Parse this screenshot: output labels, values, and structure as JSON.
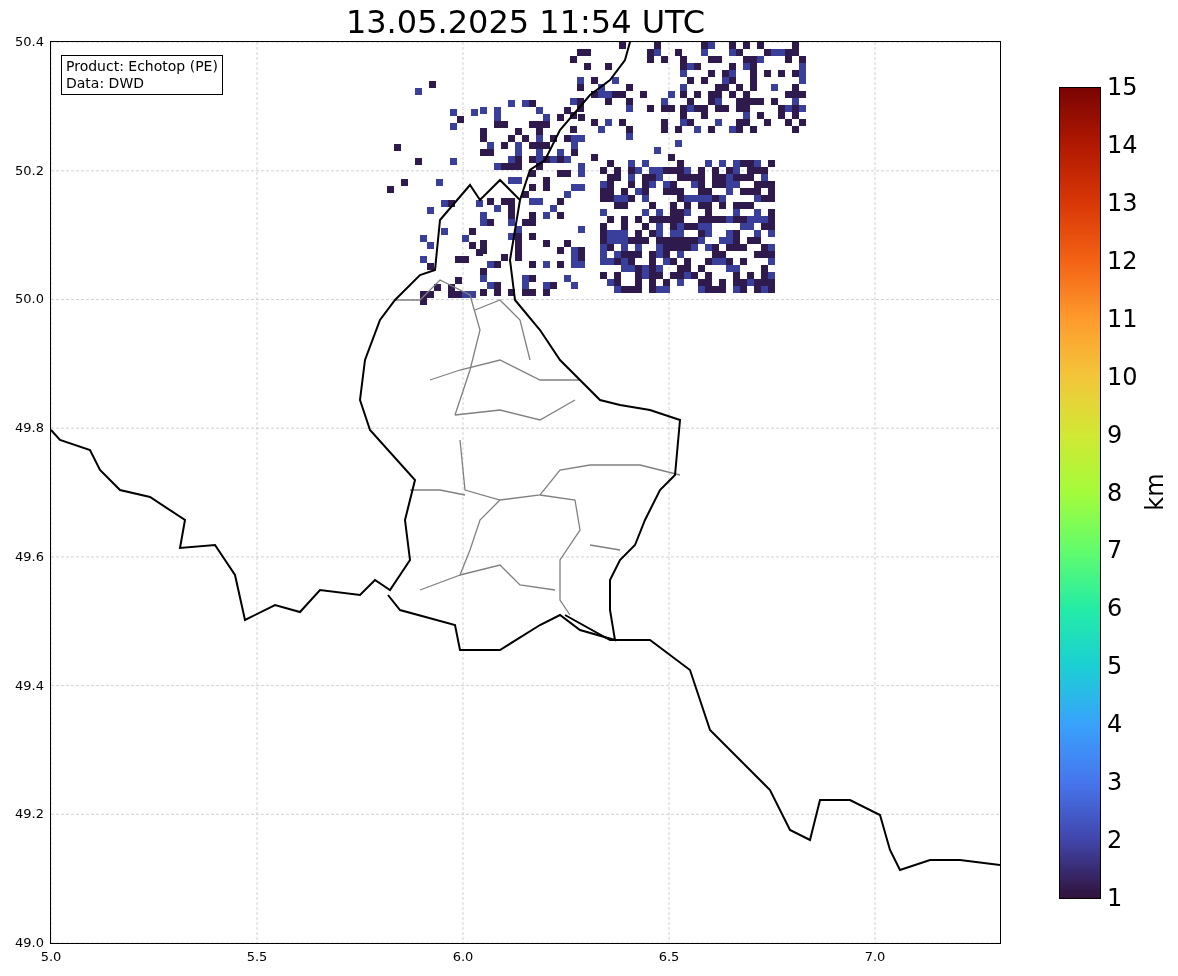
{
  "title": "13.05.2025 11:54 UTC",
  "info_box": {
    "lines": [
      "Product: Echotop (PE)",
      "Data: DWD"
    ]
  },
  "x_axis": {
    "ticks": [
      "5.0",
      "5.5",
      "6.0",
      "6.5",
      "7.0"
    ]
  },
  "y_axis": {
    "ticks": [
      "50.4",
      "50.2",
      "50.0",
      "49.8",
      "49.6",
      "49.4",
      "49.2",
      "49.0"
    ]
  },
  "colorbar": {
    "label": "km",
    "ticks": [
      "15",
      "14",
      "13",
      "12",
      "11",
      "10",
      "9",
      "8",
      "7",
      "6",
      "5",
      "4",
      "3",
      "2",
      "1"
    ]
  }
}
